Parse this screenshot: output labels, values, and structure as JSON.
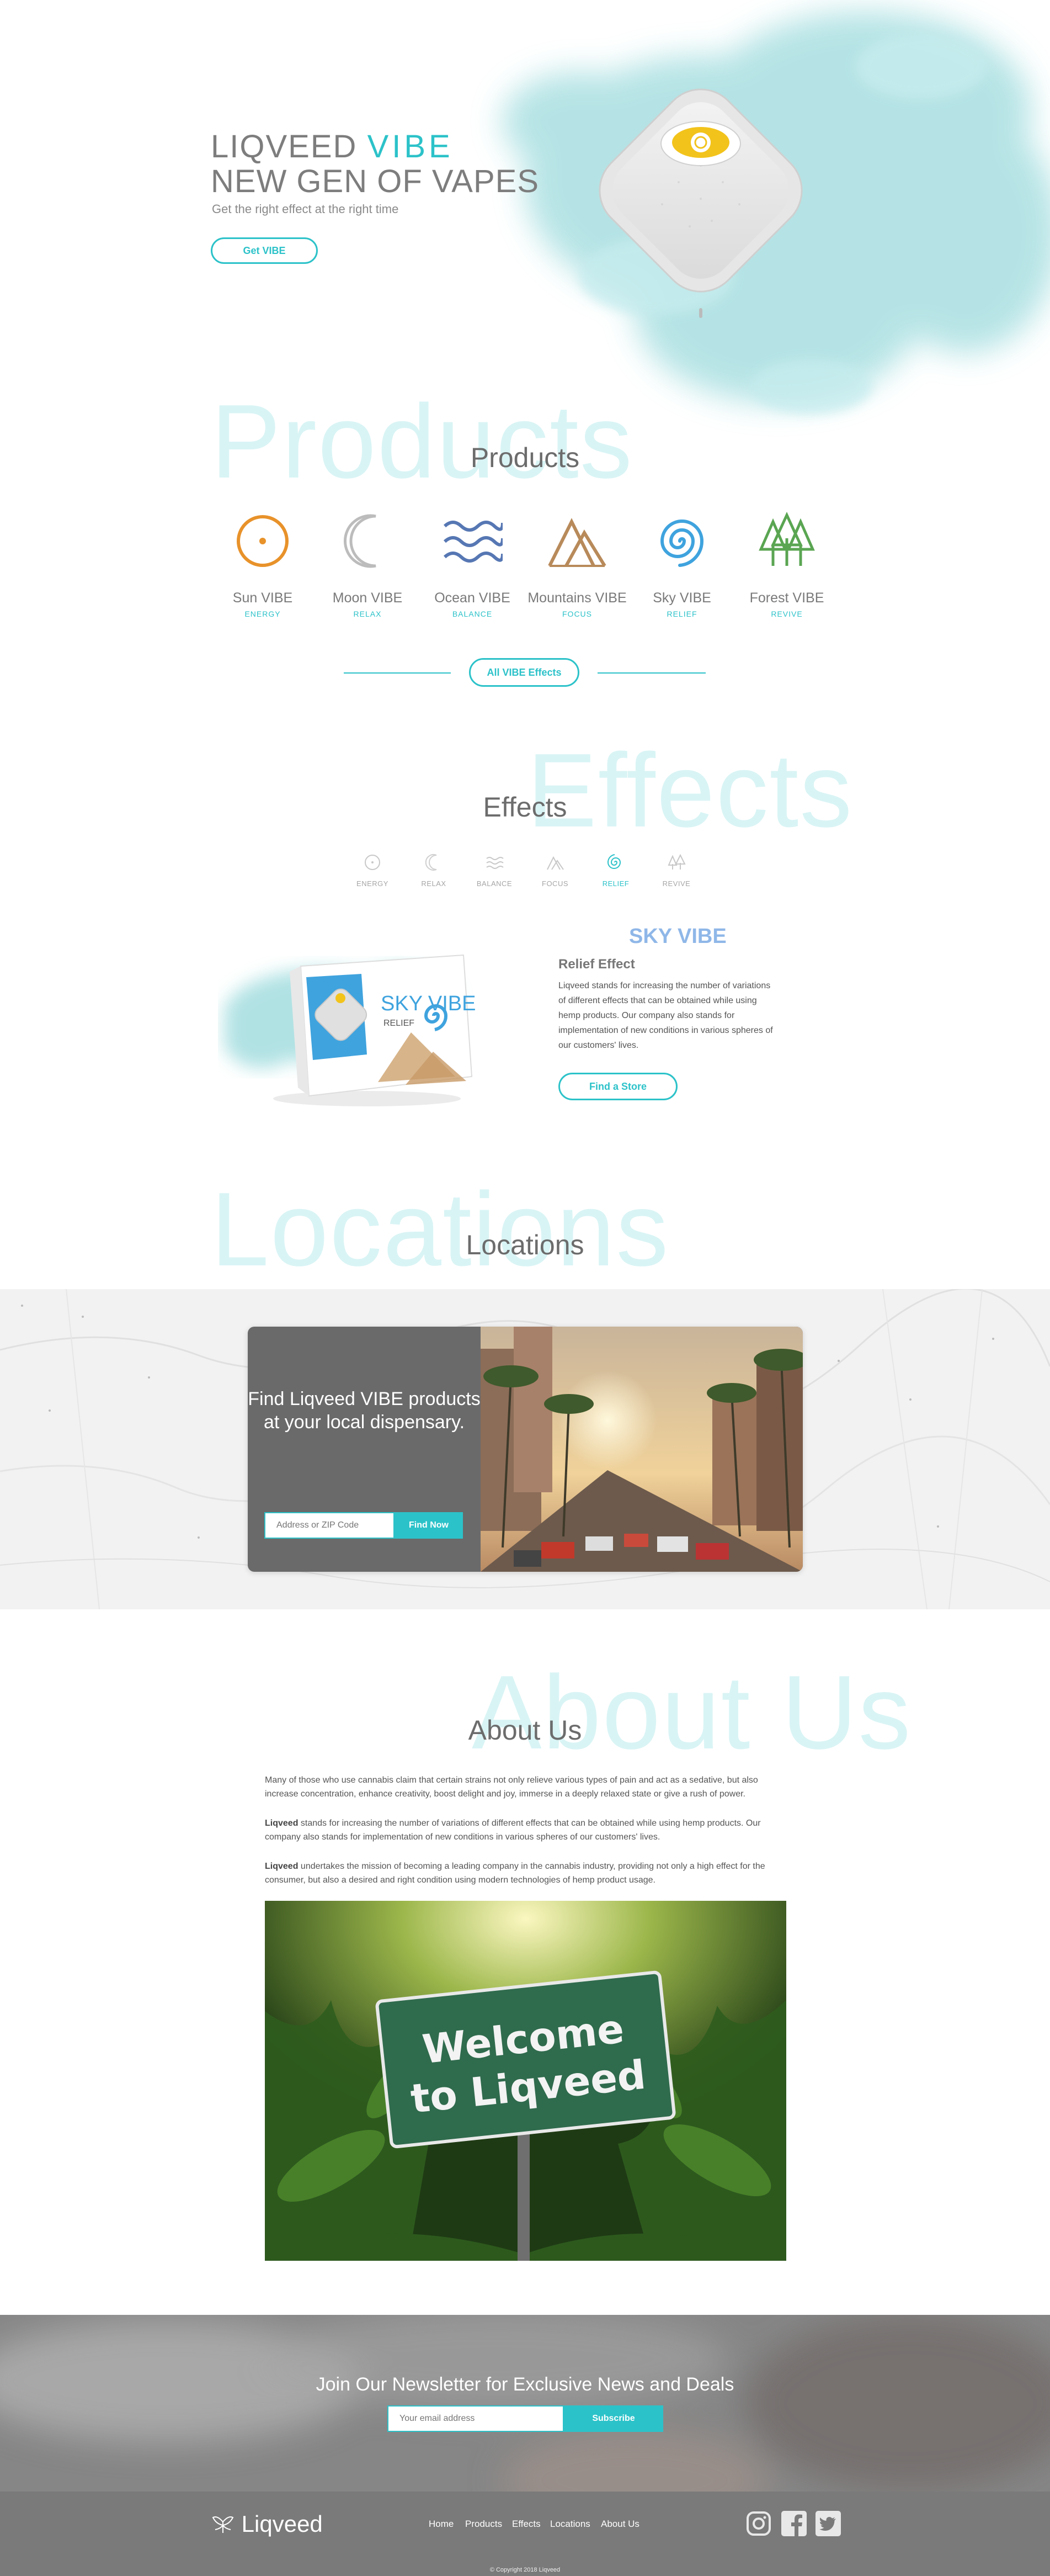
{
  "hero": {
    "title_line1_prefix": "LIQVEED",
    "title_line1_brand": "VIBE",
    "title_line2": "NEW GEN OF VAPES",
    "subtitle": "Get the right effect at the right time",
    "cta": "Get VIBE"
  },
  "products": {
    "ghost": "Products",
    "heading": "Products",
    "items": [
      {
        "name": "Sun VIBE",
        "effect": "ENERGY",
        "icon": "sun-icon",
        "color": "#e8922a"
      },
      {
        "name": "Moon VIBE",
        "effect": "RELAX",
        "icon": "moon-icon",
        "color": "#bcbcbc"
      },
      {
        "name": "Ocean VIBE",
        "effect": "BALANCE",
        "icon": "waves-icon",
        "color": "#5677b3"
      },
      {
        "name": "Mountains VIBE",
        "effect": "FOCUS",
        "icon": "mountains-icon",
        "color": "#b88a5a"
      },
      {
        "name": "Sky VIBE",
        "effect": "RELIEF",
        "icon": "spiral-icon",
        "color": "#3fa3de"
      },
      {
        "name": "Forest VIBE",
        "effect": "REVIVE",
        "icon": "trees-icon",
        "color": "#5aa552"
      }
    ],
    "all_button": "All VIBE Effects"
  },
  "effects": {
    "ghost": "Effects",
    "heading": "Effects",
    "tabs": [
      "ENERGY",
      "RELAX",
      "BALANCE",
      "FOCUS",
      "RELIEF",
      "REVIVE"
    ],
    "active_tab": "RELIEF",
    "title": "SKY VIBE",
    "subtitle": "Relief Effect",
    "description": "Liqveed stands for increasing the number of variations of different effects that can be obtained while using hemp products. Our company also stands for implementation of new conditions in various spheres of our customers' lives.",
    "cta": "Find a Store",
    "box_brand": "SKY VIBE",
    "box_effect": "RELIEF"
  },
  "locations": {
    "ghost": "Locations",
    "heading": "Locations",
    "card_text": "Find Liqveed VIBE products at your local dispensary.",
    "input_placeholder": "Address or ZIP Code",
    "button": "Find Now"
  },
  "about": {
    "ghost": "About Us",
    "heading": "About Us",
    "p1": "Many of those who use cannabis claim that certain strains not only relieve various types of pain and act as a sedative, but also increase concentration, enhance creativity, boost delight and joy, immerse in a deeply relaxed state or give a rush of power.",
    "p2_brand": "Liqveed",
    "p2": " stands for increasing the number of variations of different effects that can be obtained while using hemp products. Our company also stands for implementation of new conditions in various spheres of our customers' lives.",
    "p3_brand": "Liqveed",
    "p3": " undertakes the mission of becoming a leading company in the cannabis industry, providing not only a high effect for the consumer, but also a desired and right condition using modern technologies of hemp product usage.",
    "sign_line1": "Welcome",
    "sign_line2": "to Liqveed"
  },
  "newsletter": {
    "title": "Join Our Newsletter for Exclusive News and Deals",
    "placeholder": "Your email address",
    "button": "Subscribe"
  },
  "footer": {
    "logo": "Liqveed",
    "nav": [
      "Home",
      "Products",
      "Effects",
      "Locations",
      "About Us"
    ],
    "social": [
      "instagram-icon",
      "facebook-icon",
      "twitter-icon"
    ],
    "copyright": "© Copyright 2018 Liqveed"
  },
  "colors": {
    "accent": "#2cc2c9",
    "ghost": "#d9f4f5",
    "sky_title": "#8fb7e8"
  }
}
